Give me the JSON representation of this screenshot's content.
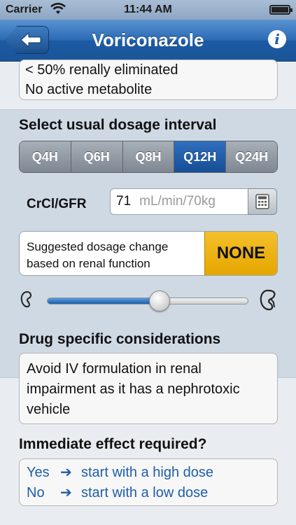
{
  "status_bar": {
    "carrier": "Carrier",
    "time": "11:44 AM"
  },
  "nav": {
    "title": "Voriconazole",
    "info_glyph": "i"
  },
  "top_card": {
    "lines": [
      "< 50% renally eliminated",
      "No active metabolite"
    ]
  },
  "dosage_interval": {
    "title": "Select usual dosage interval",
    "options": [
      "Q4H",
      "Q6H",
      "Q8H",
      "Q12H",
      "Q24H"
    ],
    "selected": "Q12H"
  },
  "crcl": {
    "label": "CrCl/GFR",
    "value": "71",
    "unit": "mL/min/70kg"
  },
  "suggestion": {
    "label_line1": "Suggested dosage change",
    "label_line2": "based on renal function",
    "value": "NONE",
    "value_color": "#f0b41a"
  },
  "renal_slider": {
    "level": 0.56
  },
  "drug_considerations": {
    "title": "Drug specific considerations",
    "text": "Avoid IV formulation in renal impairment as it has a nephrotoxic vehicle"
  },
  "immediate_effect": {
    "title": "Immediate effect required?",
    "rows": [
      {
        "answer": "Yes",
        "arrow": "➔",
        "action": "start with a high dose"
      },
      {
        "answer": "No",
        "arrow": "➔",
        "action": "start with a low dose"
      }
    ]
  },
  "colors": {
    "nav_blue": "#1f5ea7",
    "selected_segment": "#164e95",
    "link_blue": "#1f5ea7"
  }
}
